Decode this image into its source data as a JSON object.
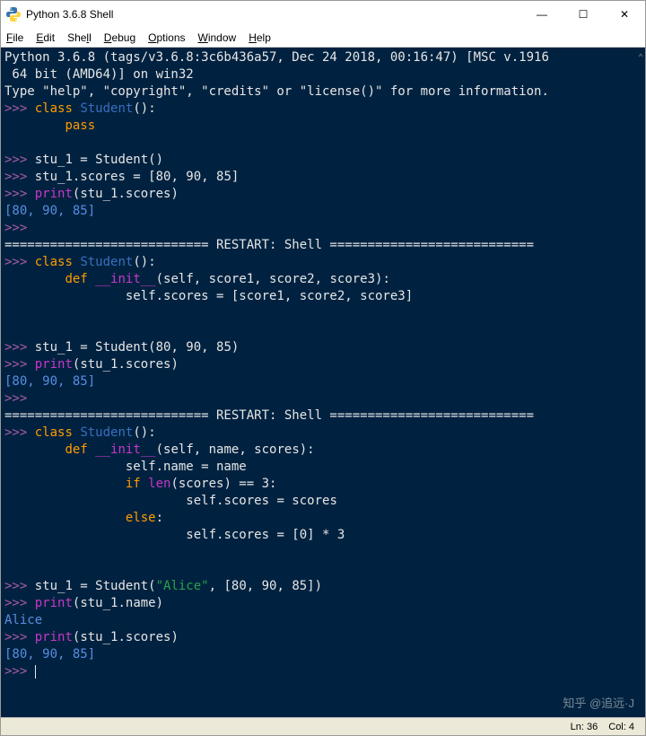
{
  "window": {
    "title": "Python 3.6.8 Shell"
  },
  "menu": {
    "file": "File",
    "edit": "Edit",
    "shell": "Shell",
    "debug": "Debug",
    "options": "Options",
    "window": "Window",
    "help": "Help"
  },
  "shell": {
    "banner1": "Python 3.6.8 (tags/v3.6.8:3c6b436a57, Dec 24 2018, 00:16:47) [MSC v.1916",
    "banner2": " 64 bit (AMD64)] on win32",
    "banner3": "Type \"help\", \"copyright\", \"credits\" or \"license()\" for more information.",
    "prompt": ">>>",
    "restart": "=========================== RESTART: Shell ===========================",
    "c1": {
      "decl": "class",
      "name": "Student",
      "par": "():",
      "body": "pass"
    },
    "s1": {
      "assign": "stu_1 = Student()",
      "setscores": "stu_1.scores = [80, 90, 85]",
      "print": "print",
      "arg": "(stu_1.scores)"
    },
    "out1": "[80, 90, 85]",
    "c2": {
      "decl": "class",
      "name": "Student",
      "par": "():",
      "def": "def",
      "init": "__init__",
      "initargs": "(self, score1, score2, score3):",
      "body": "self.scores = [score1, score2, score3]"
    },
    "s2": {
      "assign": "stu_1 = Student(80, 90, 85)",
      "print": "print",
      "arg": "(stu_1.scores)"
    },
    "out2": "[80, 90, 85]",
    "c3": {
      "decl": "class",
      "name": "Student",
      "par": "():",
      "def": "def",
      "init": "__init__",
      "initargs": "(self, name, scores):",
      "l1": "self.name = name",
      "if": "if",
      "len": "len",
      "cond": "(scores) == 3:",
      "l2": "self.scores = scores",
      "else": "else",
      "colon": ":",
      "l3": "self.scores = [0] * 3"
    },
    "s3": {
      "a": "stu_1 = Student(",
      "str": "\"Alice\"",
      "b": ", [80, 90, 85])",
      "p1": "print",
      "p1arg": "(stu_1.name)",
      "out_name": "Alice",
      "p2": "print",
      "p2arg": "(stu_1.scores)",
      "out_sc": "[80, 90, 85]"
    }
  },
  "status": {
    "line": "Ln: 36",
    "col": "Col: 4"
  },
  "watermark": "知乎 @追远·J"
}
